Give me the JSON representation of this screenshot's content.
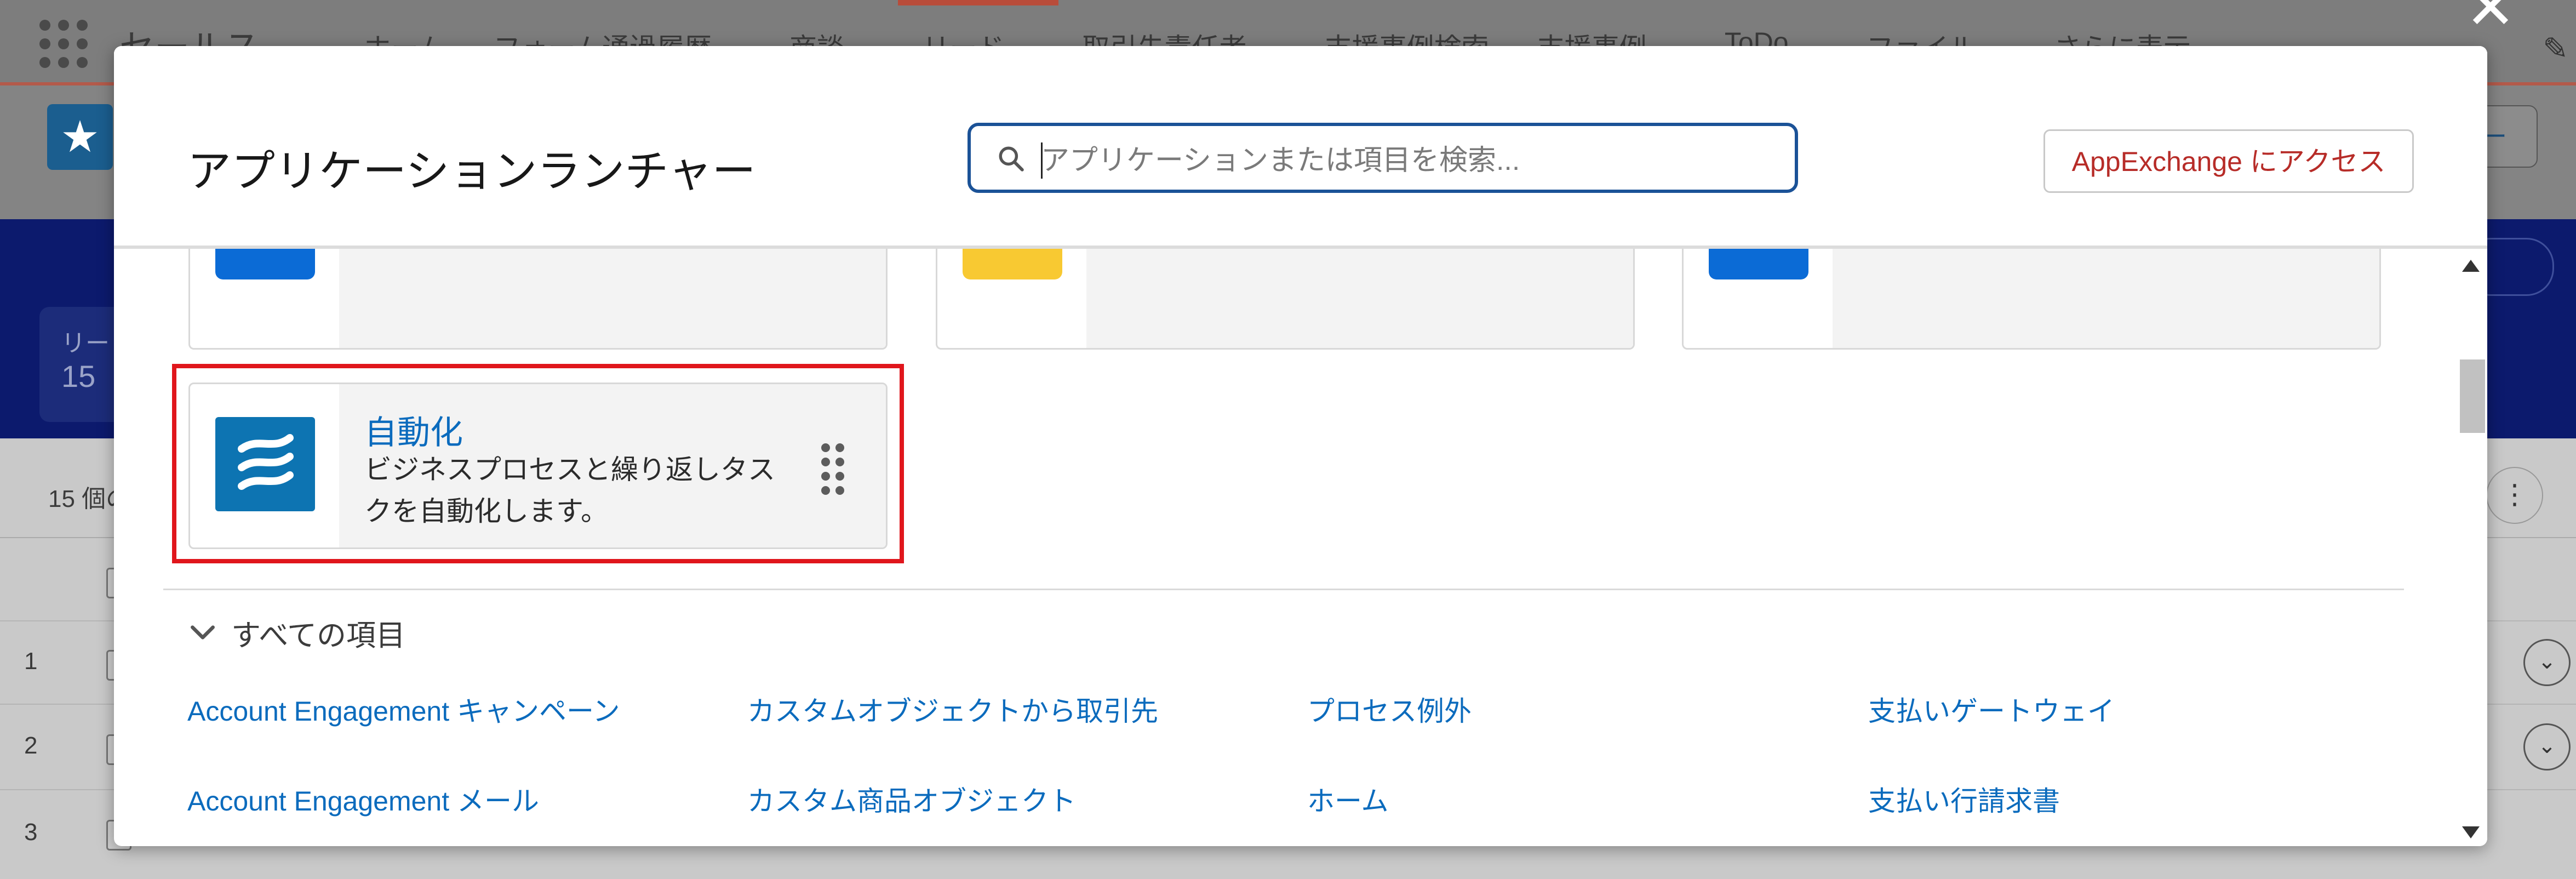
{
  "background": {
    "app_name": "セールス",
    "nav_tabs": [
      {
        "label": "ホーム",
        "has_menu": false
      },
      {
        "label": "フォーム通過履歴",
        "has_menu": true
      },
      {
        "label": "商談",
        "has_menu": true
      },
      {
        "label": "リード",
        "has_menu": true,
        "active": true
      },
      {
        "label": "取引先責任者",
        "has_menu": true
      },
      {
        "label": "支援事例検索",
        "has_menu": false
      },
      {
        "label": "支援事例",
        "has_menu": true
      },
      {
        "label": "ToDo",
        "has_menu": true
      },
      {
        "label": "ファイル",
        "has_menu": true
      },
      {
        "label": "さらに表示",
        "has_menu": true
      }
    ],
    "header_button_partial": "ュー",
    "card_label_partial": "リー",
    "card_value_partial": "15",
    "list_count_partial": "15 個の",
    "row_numbers": [
      "1",
      "2",
      "3"
    ]
  },
  "modal": {
    "title": "アプリケーションランチャー",
    "search": {
      "placeholder": "アプリケーションまたは項目を検索...",
      "value": ""
    },
    "appexchange_button": "AppExchange にアクセス",
    "partial_tiles": [
      {
        "icon_color": "#0b6bd6"
      },
      {
        "icon_color": "#f8c932"
      },
      {
        "icon_color": "#0b6bd6"
      }
    ],
    "featured_tile": {
      "name": "自動化",
      "description": "ビジネスプロセスと繰り返しタスクを自動化します。",
      "icon": "flow-waves-icon",
      "icon_color": "#0d74b2",
      "highlighted": true
    },
    "all_items": {
      "toggle_label": "すべての項目",
      "columns": [
        [
          "Account Engagement キャンペーン",
          "Account Engagement メール"
        ],
        [
          "カスタムオブジェクトから取引先",
          "カスタム商品オブジェクト"
        ],
        [
          "プロセス例外",
          "ホーム"
        ],
        [
          "支払いゲートウェイ",
          "支払い行請求書"
        ]
      ]
    }
  },
  "colors": {
    "link": "#0b6bbd",
    "search_border": "#1b5297",
    "highlight": "#e0161c",
    "appexchange_text": "#b72c28"
  }
}
